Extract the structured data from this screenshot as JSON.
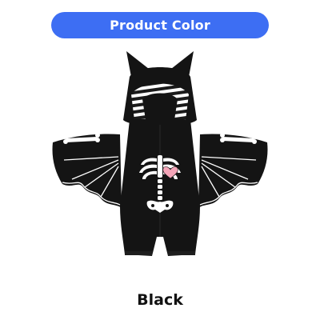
{
  "header": {
    "title": "Product Color",
    "background_color": "#3d6ef3",
    "text_color": "#ffffff"
  },
  "product": {
    "image_description_icon": "bat-costume-romper-image",
    "color_name": "Black"
  }
}
